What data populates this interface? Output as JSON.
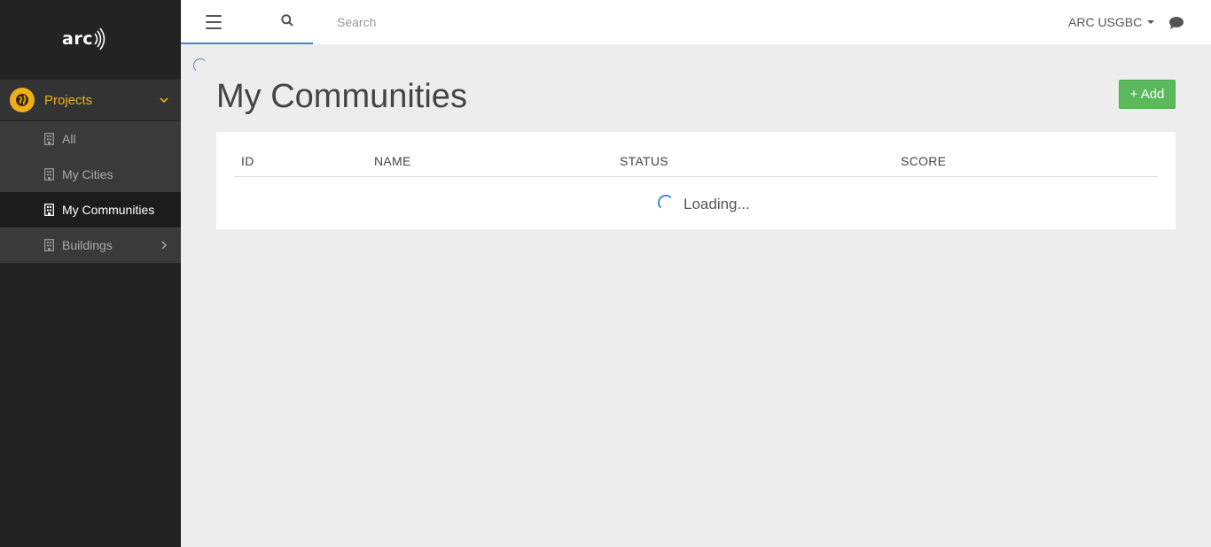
{
  "sidebar": {
    "logo": "arc",
    "projects_label": "Projects",
    "items": [
      {
        "label": "All"
      },
      {
        "label": "My Cities"
      },
      {
        "label": "My Communities"
      },
      {
        "label": "Buildings"
      }
    ]
  },
  "topbar": {
    "search_placeholder": "Search",
    "user_label": "ARC USGBC"
  },
  "main": {
    "title": "My Communities",
    "add_label": "+ Add",
    "table": {
      "headers": [
        "ID",
        "NAME",
        "STATUS",
        "SCORE"
      ],
      "loading_text": "Loading..."
    }
  },
  "colors": {
    "accent": "#f0ae1d",
    "add_button": "#5cb85c",
    "link_blue": "#4a86c6",
    "sidebar_bg": "#232323"
  },
  "icons": [
    "menu-icon",
    "search-icon",
    "chat-icon",
    "globe-icon",
    "building-icon",
    "chevron-down-icon",
    "chevron-right-icon"
  ]
}
